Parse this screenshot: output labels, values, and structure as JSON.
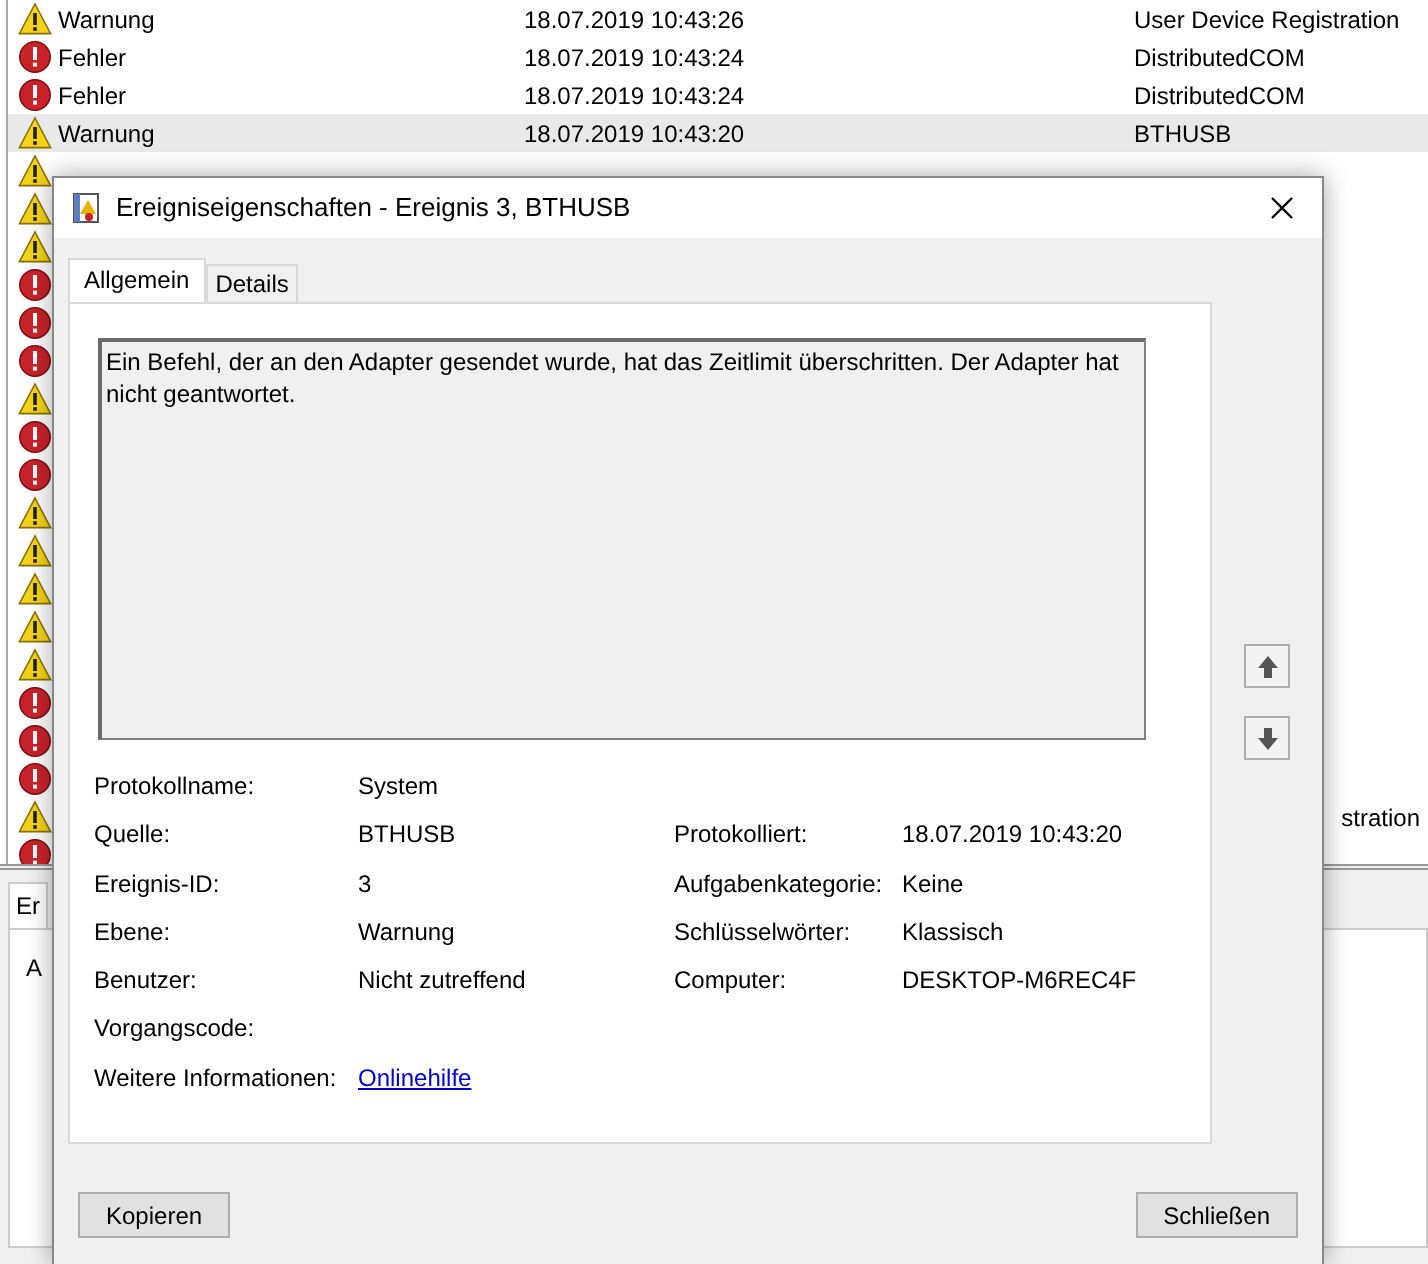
{
  "event_list": {
    "rows": [
      {
        "kind": "warning",
        "level": "Warnung",
        "date": "18.07.2019 10:43:26",
        "source": "User Device Registration",
        "selected": false
      },
      {
        "kind": "error",
        "level": "Fehler",
        "date": "18.07.2019 10:43:24",
        "source": "DistributedCOM",
        "selected": false
      },
      {
        "kind": "error",
        "level": "Fehler",
        "date": "18.07.2019 10:43:24",
        "source": "DistributedCOM",
        "selected": false
      },
      {
        "kind": "warning",
        "level": "Warnung",
        "date": "18.07.2019 10:43:20",
        "source": "BTHUSB",
        "selected": true
      },
      {
        "kind": "warning",
        "selected": false
      },
      {
        "kind": "warning",
        "selected": false
      },
      {
        "kind": "warning",
        "selected": false
      },
      {
        "kind": "error",
        "selected": false
      },
      {
        "kind": "error",
        "selected": false
      },
      {
        "kind": "error",
        "selected": false
      },
      {
        "kind": "warning",
        "selected": false
      },
      {
        "kind": "error",
        "selected": false
      },
      {
        "kind": "error",
        "selected": false
      },
      {
        "kind": "warning",
        "selected": false
      },
      {
        "kind": "warning",
        "selected": false
      },
      {
        "kind": "warning",
        "selected": false
      },
      {
        "kind": "warning",
        "selected": false
      },
      {
        "kind": "warning",
        "selected": false
      },
      {
        "kind": "error",
        "selected": false
      },
      {
        "kind": "error",
        "selected": false
      },
      {
        "kind": "error",
        "selected": false
      },
      {
        "kind": "warning",
        "source_tail": "stration",
        "selected": false
      },
      {
        "kind": "error",
        "selected": false
      }
    ]
  },
  "bottom_pane": {
    "tab": "Er",
    "label": "A"
  },
  "dialog": {
    "title": "Ereigniseigenschaften - Ereignis 3, BTHUSB",
    "tabs": [
      {
        "label": "Allgemein",
        "selected": true
      },
      {
        "label": "Details",
        "selected": false
      }
    ],
    "description": "Ein Befehl, der an den Adapter gesendet wurde, hat das Zeitlimit überschritten. Der Adapter hat nicht geantwortet.",
    "fields": [
      {
        "cells": [
          {
            "label": "Protokollname:",
            "value": "System"
          }
        ]
      },
      {
        "cells": [
          {
            "label": "Quelle:",
            "value": "BTHUSB"
          },
          {
            "label": "Protokolliert:",
            "value": "18.07.2019 10:43:20"
          }
        ]
      },
      {
        "cells": [
          {
            "label": "Ereignis-ID:",
            "value": "3"
          },
          {
            "label": "Aufgabenkategorie:",
            "value": "Keine"
          }
        ]
      },
      {
        "cells": [
          {
            "label": "Ebene:",
            "value": "Warnung"
          },
          {
            "label": "Schlüsselwörter:",
            "value": "Klassisch"
          }
        ]
      },
      {
        "cells": [
          {
            "label": "Benutzer:",
            "value": "Nicht zutreffend"
          },
          {
            "label": "Computer:",
            "value": "DESKTOP-M6REC4F"
          }
        ]
      },
      {
        "cells": [
          {
            "label": "Vorgangscode:"
          }
        ]
      },
      {
        "cells": [
          {
            "label": "Weitere Informationen:",
            "value": "Onlinehilfe",
            "kind": "link"
          }
        ]
      }
    ],
    "buttons": [
      "Kopieren",
      "Schließen"
    ]
  }
}
